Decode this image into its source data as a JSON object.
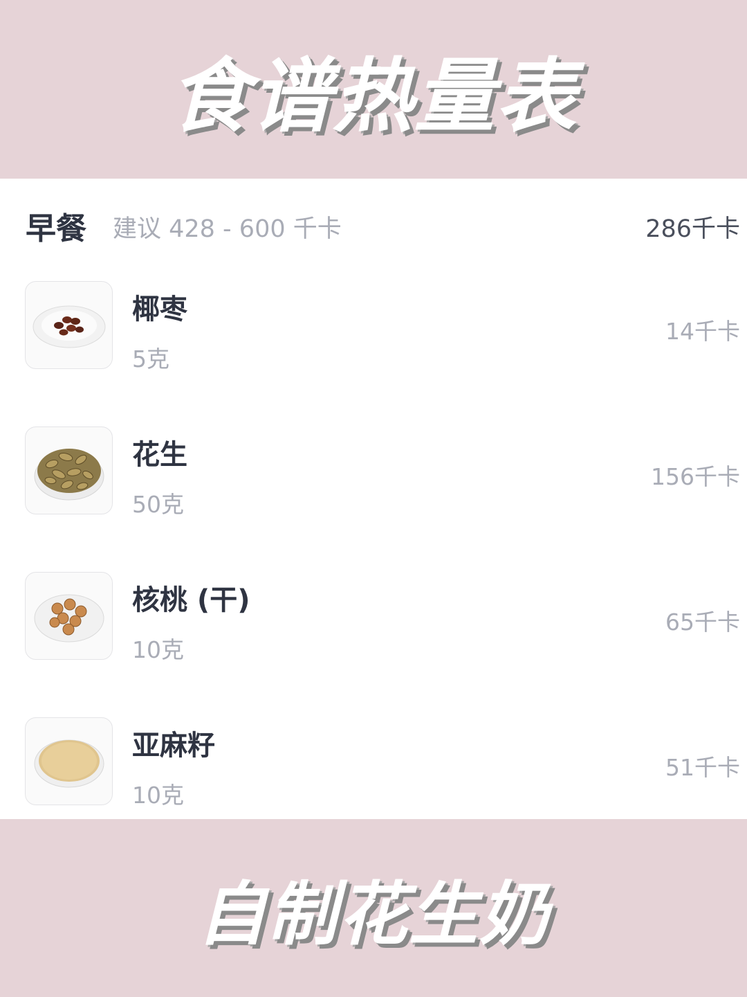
{
  "banner_top": "食谱热量表",
  "banner_bottom": "自制花生奶",
  "meal": {
    "title": "早餐",
    "suggestion": "建议 428 - 600 千卡",
    "total": "286千卡"
  },
  "items": [
    {
      "name": "椰枣",
      "amount": "5克",
      "calories": "14千卡",
      "icon": "dates-plate-icon"
    },
    {
      "name": "花生",
      "amount": "50克",
      "calories": "156千卡",
      "icon": "peanuts-plate-icon"
    },
    {
      "name": "核桃 (干)",
      "amount": "10克",
      "calories": "65千卡",
      "icon": "walnuts-plate-icon"
    },
    {
      "name": "亚麻籽",
      "amount": "10克",
      "calories": "51千卡",
      "icon": "flaxseed-plate-icon"
    }
  ],
  "colors": {
    "banner_bg": "#e6d3d7",
    "card_bg": "#ffffff",
    "title_text": "#2f3442",
    "muted_text": "#a9acb6"
  }
}
